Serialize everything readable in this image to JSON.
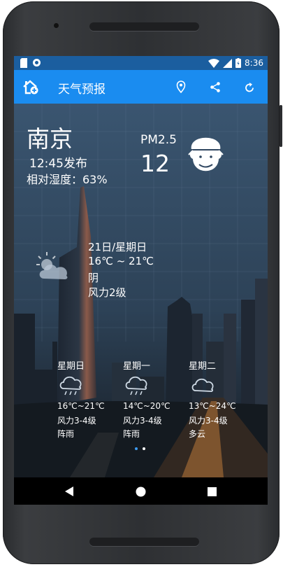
{
  "status_bar": {
    "time": "8:36"
  },
  "app_bar": {
    "title": "天气预报"
  },
  "current": {
    "city": "南京",
    "publish_time": "12:45发布",
    "humidity": "相对湿度：63%",
    "pm25_label": "PM2.5",
    "pm25_value": "12"
  },
  "today": {
    "date": "21日/星期日",
    "temp": "16℃ ~ 21℃",
    "weather": "阴",
    "wind": "风力2级"
  },
  "forecast": [
    {
      "day": "星期日",
      "temp": "16℃~21℃",
      "wind": "风力3-4级",
      "weather": "阵雨"
    },
    {
      "day": "星期一",
      "temp": "14℃~20℃",
      "wind": "风力3-4级",
      "weather": "阵雨"
    },
    {
      "day": "星期二",
      "temp": "13℃~24℃",
      "wind": "风力3-4级",
      "weather": "多云"
    }
  ],
  "pager": {
    "count": 2,
    "active": 0
  },
  "colors": {
    "status_bar": "#1b5e9f",
    "app_bar": "#1a8cf0",
    "text": "#ffffff"
  },
  "icons": [
    "sd-card-icon",
    "sync-icon",
    "wifi-icon",
    "signal-icon",
    "battery-icon",
    "add-city-icon",
    "location-icon",
    "share-icon",
    "refresh-icon",
    "cloudy-sun-icon",
    "shower-icon",
    "cloud-icon",
    "back-icon",
    "home-icon",
    "recents-icon"
  ]
}
